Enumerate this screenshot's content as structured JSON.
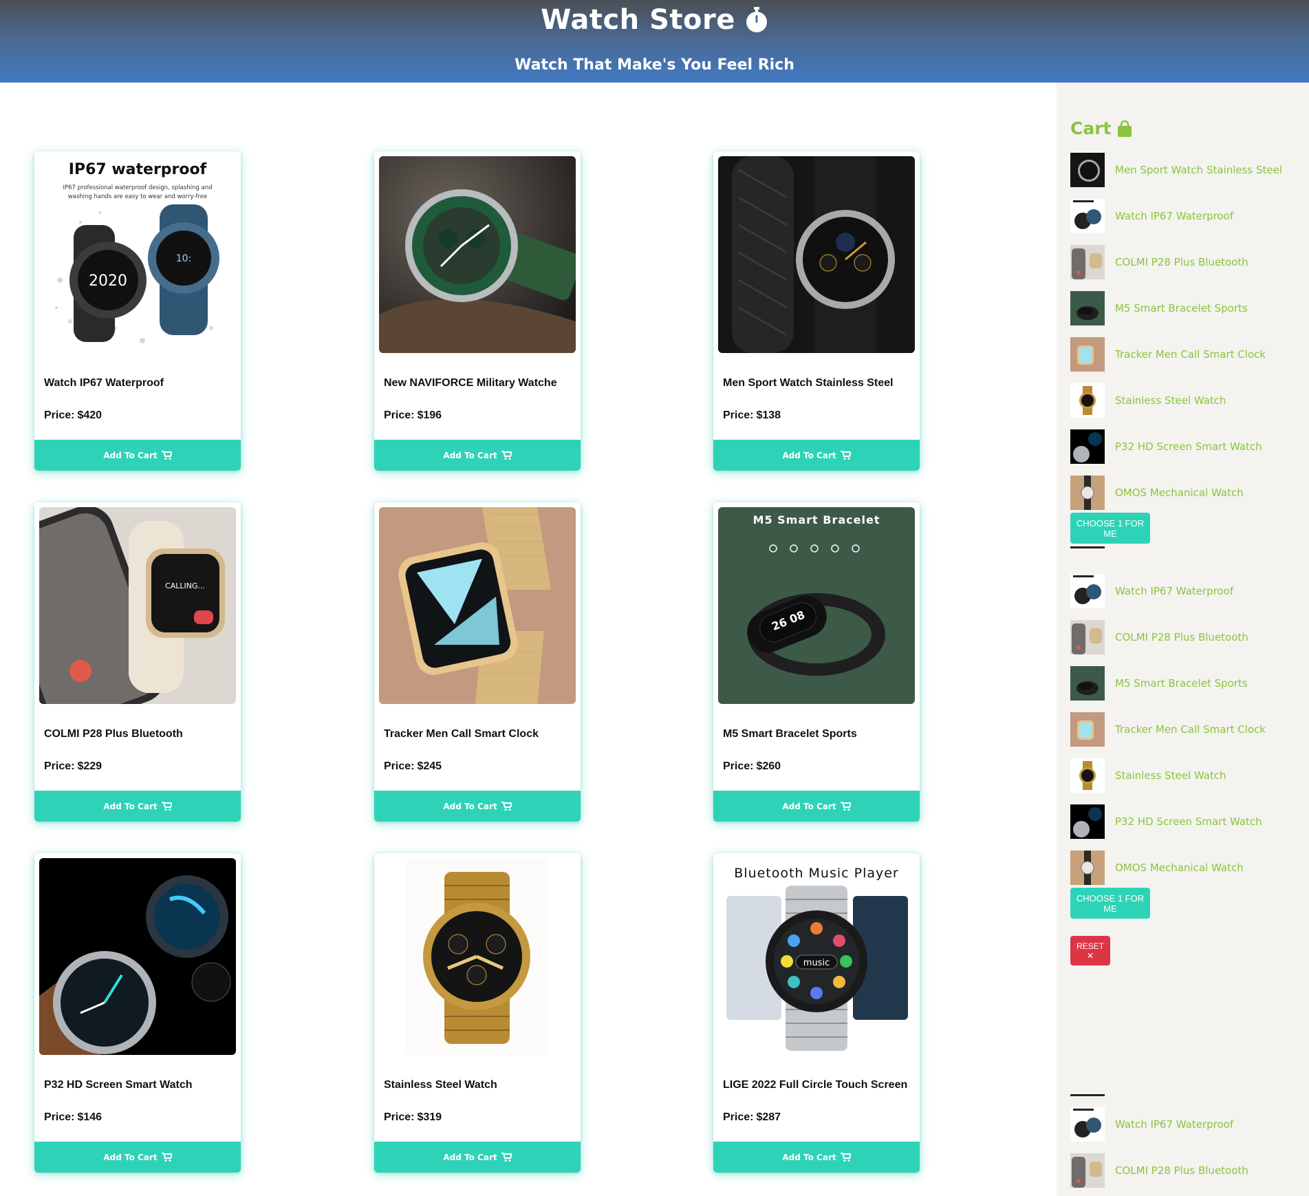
{
  "header": {
    "title": "Watch Store",
    "tagline": "Watch That Make's You Feel Rich"
  },
  "products": [
    {
      "name": "Watch IP67 Waterproof",
      "price_label": "Price:",
      "price": "$420",
      "button": "Add To Cart",
      "image_caption": "IP67 waterproof",
      "image_subcaption": "IP67 professional waterproof design, splashing and washing hands are easy to wear and worry-free",
      "image_kind": "waterproof"
    },
    {
      "name": "New NAVIFORCE Military Watche",
      "price_label": "Price:",
      "price": "$196",
      "button": "Add To Cart",
      "image_kind": "naviforce"
    },
    {
      "name": "Men Sport Watch Stainless Steel",
      "price_label": "Price:",
      "price": "$138",
      "button": "Add To Cart",
      "image_kind": "sport"
    },
    {
      "name": "COLMI P28 Plus Bluetooth",
      "price_label": "Price:",
      "price": "$229",
      "button": "Add To Cart",
      "image_kind": "colmi"
    },
    {
      "name": "Tracker Men Call Smart Clock",
      "price_label": "Price:",
      "price": "$245",
      "button": "Add To Cart",
      "image_kind": "tracker"
    },
    {
      "name": "M5 Smart Bracelet Sports",
      "price_label": "Price:",
      "price": "$260",
      "button": "Add To Cart",
      "image_caption": "M5 Smart Bracelet",
      "image_kind": "m5"
    },
    {
      "name": "P32 HD Screen Smart Watch",
      "price_label": "Price:",
      "price": "$146",
      "button": "Add To Cart",
      "image_kind": "p32"
    },
    {
      "name": "Stainless Steel Watch",
      "price_label": "Price:",
      "price": "$319",
      "button": "Add To Cart",
      "image_kind": "steel"
    },
    {
      "name": "LIGE 2022 Full Circle Touch Screen",
      "price_label": "Price:",
      "price": "$287",
      "button": "Add To Cart",
      "image_caption": "Bluetooth Music Player",
      "image_center": "music",
      "image_kind": "lige"
    }
  ],
  "cart": {
    "title": "Cart",
    "items": [
      {
        "label": "Men Sport Watch Stainless Steel",
        "kind": "sport"
      },
      {
        "label": "Watch IP67 Waterproof",
        "kind": "waterproof"
      },
      {
        "label": "COLMI P28 Plus Bluetooth",
        "kind": "colmi"
      },
      {
        "label": "M5 Smart Bracelet Sports",
        "kind": "m5"
      },
      {
        "label": "Tracker Men Call Smart Clock",
        "kind": "tracker"
      },
      {
        "label": "Stainless Steel Watch",
        "kind": "steel"
      },
      {
        "label": "P32 HD Screen Smart Watch",
        "kind": "p32"
      },
      {
        "label": "OMOS Mechanical Watch",
        "kind": "omos"
      },
      {
        "label": "Watch IP67 Waterproof",
        "kind": "waterproof"
      },
      {
        "label": "COLMI P28 Plus Bluetooth",
        "kind": "colmi"
      },
      {
        "label": "M5 Smart Bracelet Sports",
        "kind": "m5"
      },
      {
        "label": "Tracker Men Call Smart Clock",
        "kind": "tracker"
      },
      {
        "label": "Stainless Steel Watch",
        "kind": "steel"
      },
      {
        "label": "P32 HD Screen Smart Watch",
        "kind": "p32"
      },
      {
        "label": "OMOS Mechanical Watch",
        "kind": "omos"
      },
      {
        "label": "Watch IP67 Waterproof",
        "kind": "waterproof"
      },
      {
        "label": "COLMI P28 Plus Bluetooth",
        "kind": "colmi"
      }
    ],
    "choose_button": "CHOOSE 1 FOR ME",
    "reset_button": "RESET ✕"
  },
  "colors": {
    "accent": "#2ed3b7",
    "cart_text": "#8bc440",
    "reset": "#dc3545",
    "header_top": "#4b4f55",
    "header_bottom": "#4179c2"
  }
}
